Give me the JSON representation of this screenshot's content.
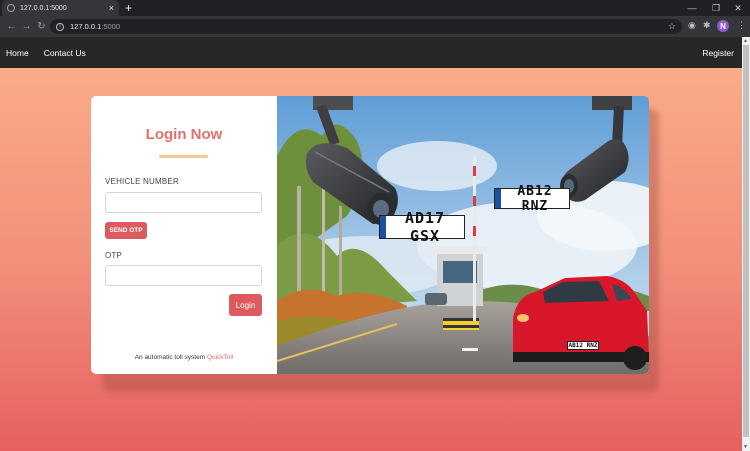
{
  "browser": {
    "tab_title": "127.0.0.1:5000",
    "tab_close": "×",
    "new_tab": "+",
    "url_host": "127.0.0.1",
    "url_port": ":5000",
    "profile_initial": "N",
    "icons": [
      "back-arrow-icon",
      "forward-arrow-icon",
      "reload-icon",
      "info-icon",
      "star-icon",
      "extension-icon",
      "puzzle-icon",
      "menu-icon"
    ]
  },
  "navbar": {
    "home": "Home",
    "contact": "Contact Us",
    "register": "Register"
  },
  "login": {
    "title": "Login Now",
    "vehicle_label": "VEHICLE NUMBER",
    "vehicle_value": "",
    "send_otp": "SEND OTP",
    "otp_label": "OTP",
    "otp_value": "",
    "login_button": "Login",
    "tagline_prefix": "An automatic toll system ",
    "tagline_link": "QuickToll"
  },
  "illustration": {
    "plate_1": "AD17 GSX",
    "plate_2": "AB12 RNZ",
    "plate_3": "AB12 RNZ"
  },
  "colors": {
    "accent": "#db5b5e",
    "title": "#e0706a",
    "navbar": "#272727",
    "gradient_top": "#fbb08b",
    "gradient_bottom": "#e6605f"
  }
}
